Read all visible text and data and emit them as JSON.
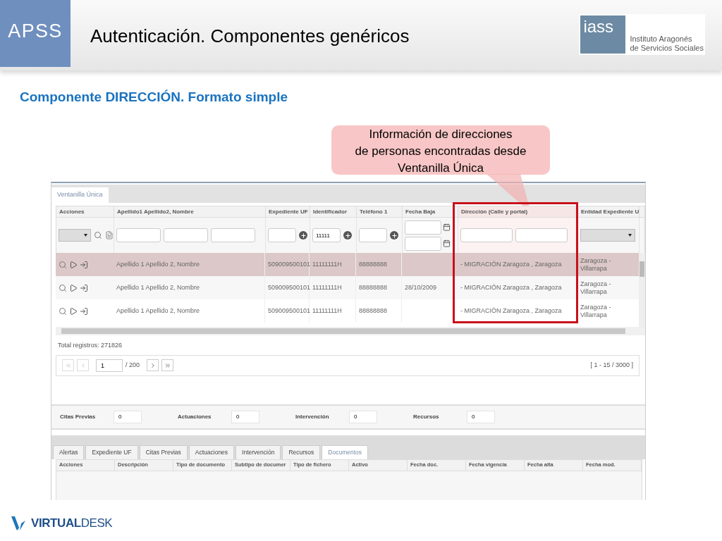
{
  "header": {
    "badge": "APSS",
    "title": "Autenticación. Componentes genéricos",
    "logo": {
      "mark": "iass",
      "line1": "Instituto Aragonés",
      "line2": "de Servicios Sociales"
    }
  },
  "subtitle": "Componente DIRECCIÓN. Formato simple",
  "callout": {
    "lines": [
      "Información de direcciones",
      "de personas encontradas desde",
      "Ventanilla Única"
    ]
  },
  "app": {
    "tabs": [
      {
        "label": "Ventanilla Única",
        "selected": true
      }
    ],
    "columns": [
      {
        "label": "Acciones",
        "kind": "select_actions",
        "highlighted": false
      },
      {
        "label": "Apellido1 Apellido2, Nombre",
        "kind": "text3",
        "highlighted": false
      },
      {
        "label": "Expediente UF",
        "kind": "text_add",
        "highlighted": false
      },
      {
        "label": "Identificador",
        "kind": "text_add",
        "filter_value": "11111",
        "highlighted": false
      },
      {
        "label": "Teléfono 1",
        "kind": "text_add",
        "highlighted": false
      },
      {
        "label": "Fecha Baja",
        "kind": "date2",
        "highlighted": false
      },
      {
        "label": "Dirección (Calle y portal)",
        "kind": "text2",
        "highlighted": true
      },
      {
        "label": "Entidad Expediente U",
        "kind": "select",
        "highlighted": false
      }
    ],
    "rows": [
      {
        "selected": true,
        "name": "Apellido 1 Apellido 2, Nombre",
        "expediente": "509009500101",
        "identificador": "11111111H",
        "telefono": "88888888",
        "direccion": "- MIGRACIÓN Zaragoza , Zaragoza",
        "entidad": "Zaragoza - Villarrapa"
      },
      {
        "selected": false,
        "name": "Apellido 1 Apellido 2, Nombre",
        "expediente": "509009500101",
        "identificador": "11111111H",
        "telefono": "88888888",
        "fecha_baja": "28/10/2009",
        "direccion": "- MIGRACIÓN Zaragoza , Zaragoza",
        "entidad": "Zaragoza - Villarrapa"
      },
      {
        "selected": false,
        "name": "Apellido 1 Apellido 2, Nombre",
        "expediente": "509009500101",
        "identificador": "11111111H",
        "telefono": "88888888",
        "direccion": "- MIGRACIÓN Zaragoza , Zaragoza",
        "entidad": "Zaragoza - Villarrapa"
      }
    ],
    "total": "Total registros: 271826",
    "pager": {
      "page": "1",
      "of": "/ 200",
      "range": "[ 1 - 15 / 3000 ]"
    },
    "counters": [
      {
        "label": "Citas Previas",
        "value": "0"
      },
      {
        "label": "Actuaciones",
        "value": "0"
      },
      {
        "label": "Intervención",
        "value": "0"
      },
      {
        "label": "Recursos",
        "value": "0"
      }
    ],
    "bottom_tabs": [
      {
        "label": "Alertas",
        "selected": false
      },
      {
        "label": "Expediente UF",
        "selected": false
      },
      {
        "label": "Citas Previas",
        "selected": false
      },
      {
        "label": "Actuaciones",
        "selected": false
      },
      {
        "label": "Intervención",
        "selected": false
      },
      {
        "label": "Recursos",
        "selected": false
      },
      {
        "label": "Documentos",
        "selected": true
      }
    ],
    "doc_columns": [
      "Acciones",
      "Descripción",
      "Tipo de documento",
      "Subtipo de documer",
      "Tipo de fichero",
      "Activo",
      "Fecha doc.",
      "Fecha vigencia",
      "Fecha alta",
      "Fecha mod."
    ]
  },
  "footer_logo": {
    "bold": "VIRTUAL",
    "light": "DESK"
  }
}
